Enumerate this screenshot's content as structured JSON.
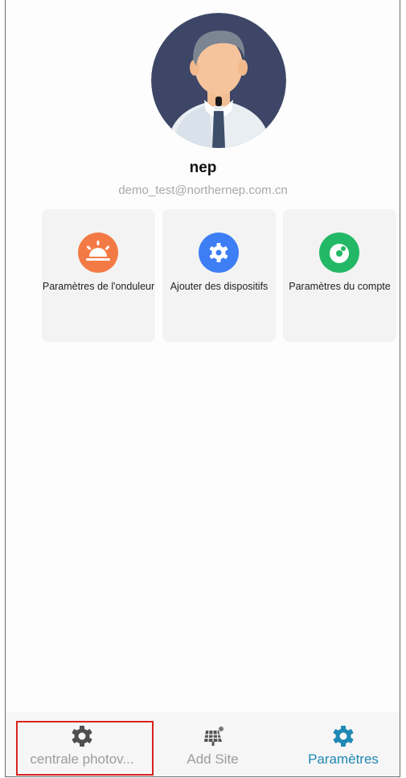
{
  "profile": {
    "username": "nep",
    "email": "demo_test@northernep.com.cn"
  },
  "cards": [
    {
      "label": "Paramètres de l'onduleur",
      "icon": "sunrise-icon",
      "color": "#f47a45"
    },
    {
      "label": "Ajouter des dispositifs",
      "icon": "gear-icon",
      "color": "#3d7ef5"
    },
    {
      "label": "Paramètres du compte",
      "icon": "account-icon",
      "color": "#22b866"
    }
  ],
  "nav": {
    "items": [
      {
        "label": "centrale photov...",
        "icon": "gear-outline-icon",
        "active": false
      },
      {
        "label": "Add Site",
        "icon": "solar-panel-icon",
        "active": false
      },
      {
        "label": "Paramètres",
        "icon": "settings-icon",
        "active": true
      }
    ],
    "active_color": "#1f88b4",
    "inactive_color": "#9c9c9c"
  },
  "colors": {
    "highlight": "#d8231f"
  }
}
